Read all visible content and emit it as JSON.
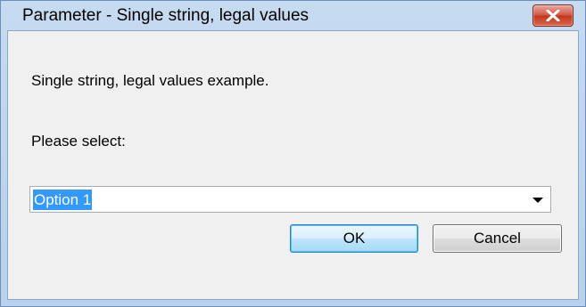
{
  "window": {
    "title": "Parameter - Single string, legal values"
  },
  "dialog": {
    "description": "Single string, legal values example.",
    "prompt": "Please select:",
    "select_value": "Option 1",
    "ok_label": "OK",
    "cancel_label": "Cancel"
  },
  "icons": {
    "close": "close-icon",
    "dropdown": "chevron-down-icon"
  },
  "colors": {
    "selection": "#3399ff",
    "close_button": "#c7402b",
    "title_bar": "#b9d1ec"
  }
}
